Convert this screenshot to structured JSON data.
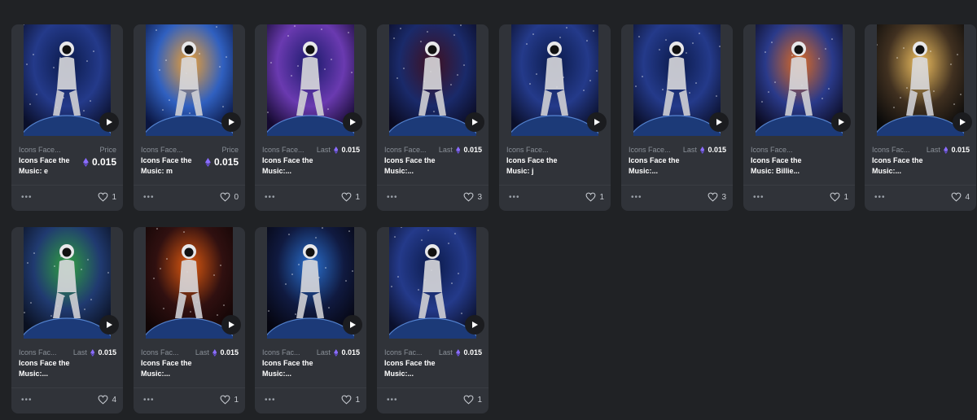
{
  "colors": {
    "page_bg": "#202225",
    "card_bg": "#303339",
    "eth_accent": "#8a6cff"
  },
  "icons": {
    "play": "play-icon",
    "eth": "ethereum-icon",
    "heart": "heart-icon",
    "more": "more-options-icon"
  },
  "cards": [
    {
      "collection": "Icons Face...",
      "title": "Icons Face the Music: e",
      "price_type": "price",
      "price_label": "Price",
      "price": "0.015",
      "likes": "1",
      "art": "space"
    },
    {
      "collection": "Icons Face...",
      "title": "Icons Face the Music: m",
      "price_type": "price",
      "price_label": "Price",
      "price": "0.015",
      "likes": "0",
      "art": "sun"
    },
    {
      "collection": "Icons Face...",
      "title": "Icons Face the Music:...",
      "price_type": "last",
      "price_label": "Last",
      "price": "0.015",
      "likes": "1",
      "art": "light"
    },
    {
      "collection": "Icons Face...",
      "title": "Icons Face the Music:...",
      "price_type": "last",
      "price_label": "Last",
      "price": "0.015",
      "likes": "3",
      "art": "red"
    },
    {
      "collection": "Icons Face...",
      "title": "Icons Face the Music: j",
      "price_type": "none",
      "price_label": "",
      "price": "",
      "likes": "1",
      "art": "space"
    },
    {
      "collection": "Icons Face...",
      "title": "Icons Face the Music:...",
      "price_type": "last",
      "price_label": "Last",
      "price": "0.015",
      "likes": "3",
      "art": "space"
    },
    {
      "collection": "Icons Face...",
      "title": "Icons Face the Music: Billie...",
      "price_type": "none",
      "price_label": "",
      "price": "",
      "likes": "1",
      "art": "warm"
    },
    {
      "collection": "Icons Fac...",
      "title": "Icons Face the Music:...",
      "price_type": "last",
      "price_label": "Last",
      "price": "0.015",
      "likes": "4",
      "art": "glow"
    },
    {
      "collection": "Icons Fac...",
      "title": "Icons Face the Music:...",
      "price_type": "last",
      "price_label": "Last",
      "price": "0.015",
      "likes": "4",
      "art": "green"
    },
    {
      "collection": "Icons Fac...",
      "title": "Icons Face the Music:...",
      "price_type": "last",
      "price_label": "Last",
      "price": "0.015",
      "likes": "1",
      "art": "fire"
    },
    {
      "collection": "Icons Fac...",
      "title": "Icons Face the Music:...",
      "price_type": "last",
      "price_label": "Last",
      "price": "0.015",
      "likes": "1",
      "art": "blue"
    },
    {
      "collection": "Icons Fac...",
      "title": "Icons Face the Music:...",
      "price_type": "last",
      "price_label": "Last",
      "price": "0.015",
      "likes": "1",
      "art": "space"
    }
  ]
}
